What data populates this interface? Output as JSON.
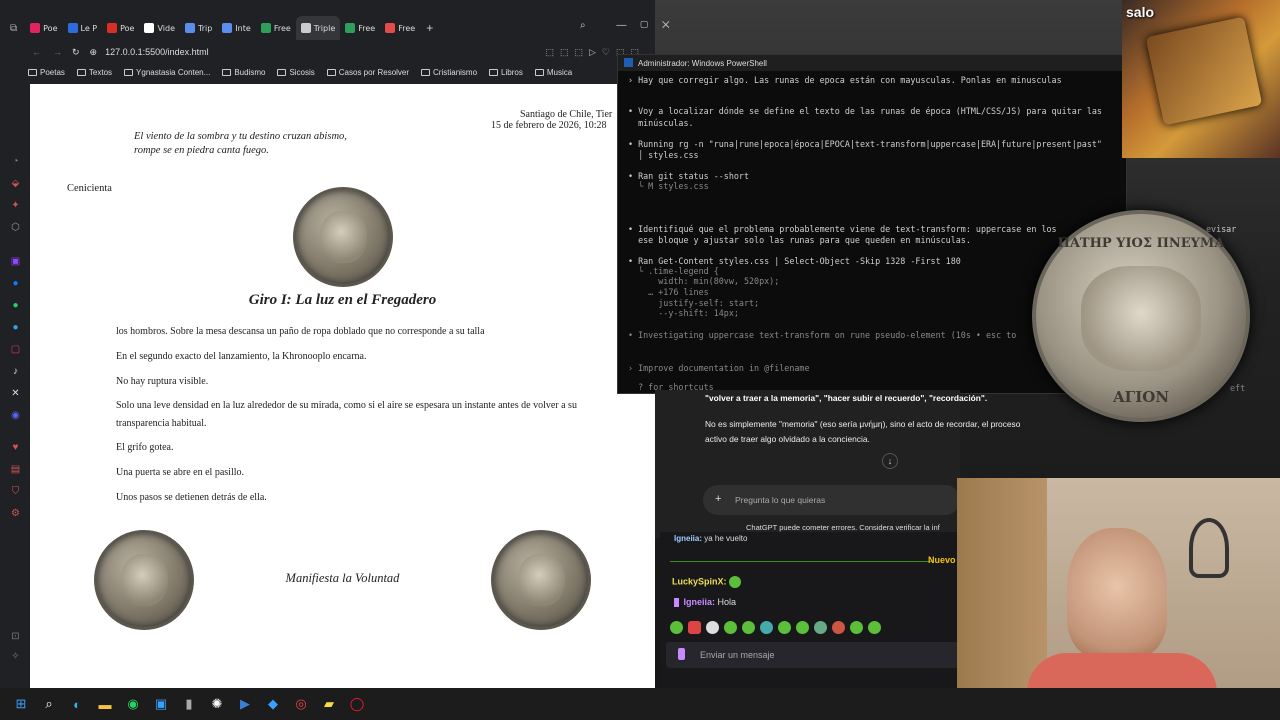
{
  "browser": {
    "tabs": [
      {
        "label": "Poe",
        "color": "#e0245e"
      },
      {
        "label": "Le P",
        "color": "#2d6cdf"
      },
      {
        "label": "Poe",
        "color": "#d93025"
      },
      {
        "label": "Vide",
        "color": "#ffffff"
      },
      {
        "label": "Trip",
        "color": "#5a8dee"
      },
      {
        "label": "Inte",
        "color": "#5a8dee"
      },
      {
        "label": "Free",
        "color": "#2e9e5b"
      },
      {
        "label": "Triple",
        "color": "#cccccc",
        "active": true
      },
      {
        "label": "Free",
        "color": "#2e9e5b"
      },
      {
        "label": "Free",
        "color": "#e44c4c"
      }
    ],
    "url": "127.0.0.1:5500/index.html",
    "bookmarks": [
      "Poetas",
      "Textos",
      "Ygnastasia Conten...",
      "Budismo",
      "Sicosis",
      "Casos por Resolver",
      "Cristianismo",
      "Libros",
      "Musica"
    ]
  },
  "page": {
    "location": "Santiago de Chile, Tier",
    "date": "15 de febrero de 2026, 10:28",
    "epigraph_1": "El viento de la sombra y tu destino cruzan abismo,",
    "epigraph_2": "rompe se en piedra canta fuego.",
    "side_label": "Cenicienta",
    "title": "Giro I: La luz en el Fregadero",
    "paragraphs": [
      "los hombros. Sobre la mesa descansa un paño de ropa doblado que no corresponde a su talla",
      "En el segundo exacto del lanzamiento, la Khronooplo encarna.",
      "No hay ruptura visible.",
      "Solo una leve densidad en la luz alrededor de su mirada, como si el aire se espesara un instante antes de volver a su transparencia habitual.",
      "El grifo gotea.",
      "Una puerta se abre en el pasillo.",
      "Unos pasos se detienen detrás de ella."
    ],
    "manifest": "Manifiesta la Voluntad"
  },
  "powershell": {
    "title": "Administrador: Windows PowerShell",
    "lines": [
      {
        "text": "› Hay que corregir algo. Las runas de epoca están con mayusculas. Ponlas en minusculas",
        "color": "#cfcfcf"
      },
      {
        "text": "• Voy a localizar dónde se define el texto de las runas de época (HTML/CSS/JS) para quitar las",
        "color": "#cfcfcf"
      },
      {
        "text": "  minúsculas.",
        "color": "#cfcfcf"
      },
      {
        "text": "• Running rg -n \"runa|rune|epoca|época|EPOCA|text-transform|uppercase|ERA|future|present|past\"",
        "color": "#cfcfcf"
      },
      {
        "text": "  │ styles.css",
        "color": "#cfcfcf"
      },
      {
        "text": "• Ran git status --short",
        "color": "#cfcfcf"
      },
      {
        "text": "  └ M styles.css",
        "color": "#888888"
      },
      {
        "text": "• Identifiqué que el problema probablemente viene de text-transform: uppercase en los",
        "color": "#cfcfcf"
      },
      {
        "text": "  ese bloque y ajustar solo las runas para que queden en minúsculas.",
        "color": "#cfcfcf"
      },
      {
        "text": "• Ran Get-Content styles.css | Select-Object -Skip 1328 -First 180",
        "color": "#cfcfcf"
      },
      {
        "text": "  └ .time-legend {",
        "color": "#888888"
      },
      {
        "text": "      width: min(80vw, 520px);",
        "color": "#888888"
      },
      {
        "text": "    … +176 lines",
        "color": "#888888"
      },
      {
        "text": "      justify-self: start;",
        "color": "#888888"
      },
      {
        "text": "      --y-shift: 14px;",
        "color": "#888888"
      },
      {
        "text": "• Investigating uppercase text-transform on rune pseudo-element (10s • esc to",
        "color": "#888888"
      },
      {
        "text": "› Improve documentation in @filename",
        "color": "#888888"
      },
      {
        "text": "  ? for shortcuts",
        "color": "#888888"
      }
    ],
    "right_fragment_1": "evisar",
    "right_fragment_2": "eft"
  },
  "chatgpt": {
    "quote_line": "\"volver a traer a la memoria\", \"hacer subir el recuerdo\", \"recordación\".",
    "para_1": "No es simplemente \"memoria\" (eso sería μνήμη), sino el acto de recordar, el proceso",
    "para_2": "activo de traer algo olvidado a la conciencia.",
    "placeholder": "Pregunta lo que quieras",
    "disclaimer": "ChatGPT puede cometer errores. Considera verificar la inf"
  },
  "twitch": {
    "msg_top": {
      "user": "Igneiia:",
      "text": "ya he vuelto"
    },
    "new_label": "Nuevo",
    "msg_1": {
      "user": "LuckySpinX:",
      "text": ""
    },
    "msg_2": {
      "user": "Igneiia:",
      "text": "Hola"
    },
    "input_placeholder": "Enviar un mensaje"
  },
  "overlay": {
    "thumb_title": "salo",
    "coin_top": "ΠΑΤΗΡ ΥΙΟΣ ΠΝΕΥΜΑ",
    "coin_bottom": "ΑΓΙΟΝ"
  },
  "coins": {
    "center_text": "ΠΝΕΥΜΑ ΑΓΙΟΝ",
    "left_text": "ΠΑΤΗΡ",
    "right_text": "ΥΙΟΣ"
  }
}
